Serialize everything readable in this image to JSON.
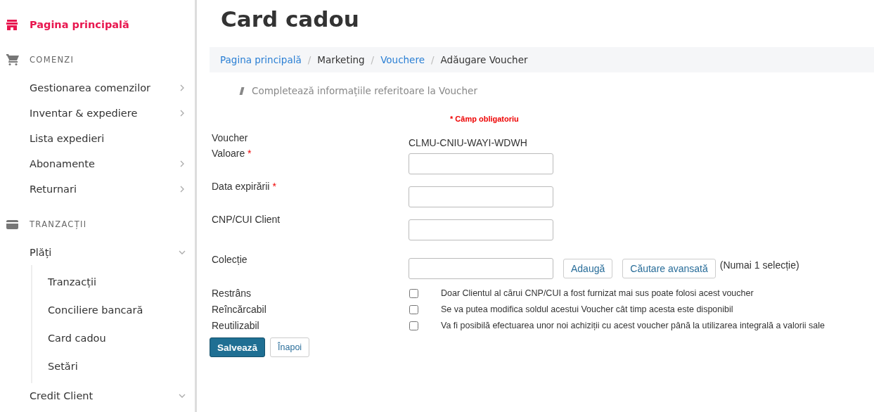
{
  "sidebar": {
    "items": [
      {
        "kind": "link",
        "label": "Pagina principală",
        "selected": true
      },
      {
        "kind": "section",
        "label": "COMENZI"
      },
      {
        "kind": "item",
        "label": "Gestionarea comenzilor",
        "expanded": false
      },
      {
        "kind": "item",
        "label": "Inventar & expediere",
        "expanded": false
      },
      {
        "kind": "item",
        "label": "Lista expedieri"
      },
      {
        "kind": "item",
        "label": "Abonamente",
        "expanded": false
      },
      {
        "kind": "item",
        "label": "Returnari",
        "expanded": false
      },
      {
        "kind": "section",
        "label": "TRANZACȚII"
      },
      {
        "kind": "item",
        "label": "Plăți",
        "expanded": true,
        "children": [
          {
            "label": "Tranzacții"
          },
          {
            "label": "Conciliere bancară"
          },
          {
            "label": "Card cadou"
          },
          {
            "label": "Setări"
          }
        ]
      },
      {
        "kind": "item",
        "label": "Credit Client",
        "expanded": true
      }
    ]
  },
  "page": {
    "title": "Card cadou"
  },
  "breadcrumb": {
    "separator": "/",
    "items": [
      {
        "label": "Pagina principală",
        "link": true
      },
      {
        "label": "Marketing",
        "link": false
      },
      {
        "label": "Vouchere",
        "link": true
      },
      {
        "label": "Adăugare Voucher",
        "link": false
      }
    ]
  },
  "form": {
    "heading": "Completează informațiile referitoare la Voucher",
    "required_note": "* Câmp obligatoriu",
    "required_mark": "*",
    "fields": [
      {
        "kind": "text",
        "label": "Voucher",
        "value": "CLMU-CNIU-WAYI-WDWH"
      },
      {
        "kind": "input",
        "label": "Valoare",
        "required": true
      },
      {
        "kind": "input",
        "label": "Data expirării",
        "required": true
      },
      {
        "kind": "input",
        "label": "CNP/CUI Client",
        "required": false
      },
      {
        "kind": "lookup",
        "label": "Colecție",
        "buttons": [
          "Adaugă",
          "Căutare avansată"
        ],
        "note": "(Numai 1 selecție)"
      }
    ],
    "checkboxes": [
      {
        "label": "Restrâns",
        "checked": false,
        "description": "Doar Clientul al cărui CNP/CUI a fost furnizat mai sus poate folosi acest voucher"
      },
      {
        "label": "Reîncărcabil",
        "checked": false,
        "description": "Se va putea modifica soldul acestui Voucher cât timp acesta este disponibil"
      },
      {
        "label": "Reutilizabil",
        "checked": false,
        "description": "Va fi posibilă efectuarea unor noi achiziții cu acest voucher până la utilizarea integrală a valorii sale"
      }
    ],
    "actions": [
      {
        "kind": "primary",
        "label": "Salvează"
      },
      {
        "kind": "secondary",
        "label": "Înapoi"
      }
    ]
  }
}
